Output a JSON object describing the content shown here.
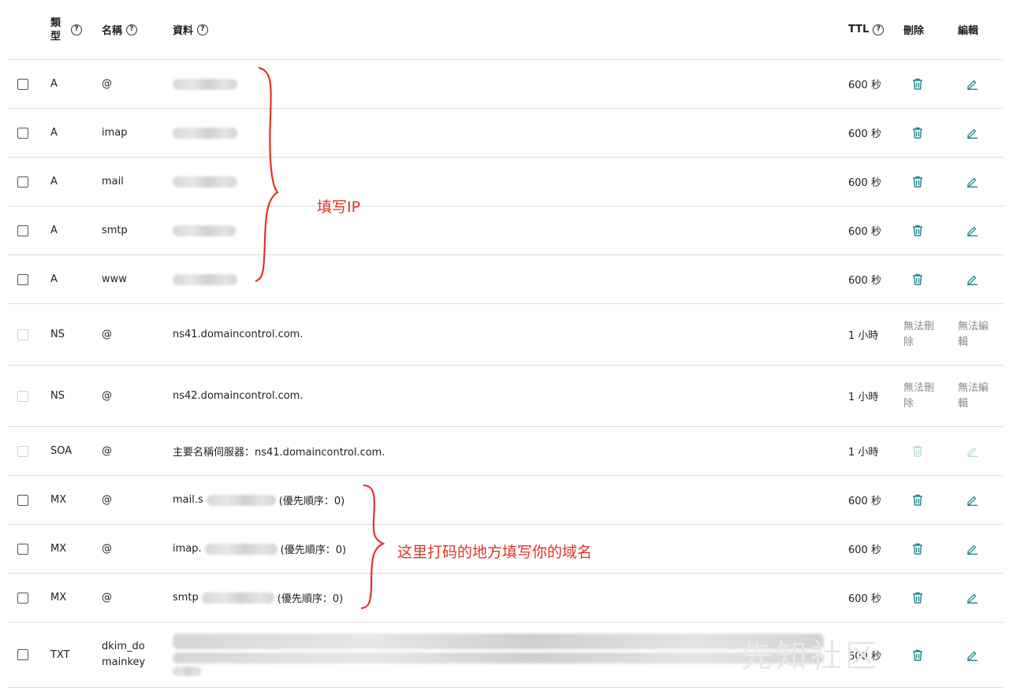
{
  "header": {
    "type_label": "類型",
    "name_label": "名稱",
    "data_label": "資料",
    "ttl_label": "TTL",
    "delete_label": "刪除",
    "edit_label": "編輯"
  },
  "rows": [
    {
      "type": "A",
      "name": "@",
      "data": "",
      "ttl": "600 秒"
    },
    {
      "type": "A",
      "name": "imap",
      "data": "",
      "ttl": "600 秒"
    },
    {
      "type": "A",
      "name": "mail",
      "data": "",
      "ttl": "600 秒"
    },
    {
      "type": "A",
      "name": "smtp",
      "data": "",
      "ttl": "600 秒"
    },
    {
      "type": "A",
      "name": "www",
      "data": "",
      "ttl": "600 秒"
    },
    {
      "type": "NS",
      "name": "@",
      "data": "ns41.domaincontrol.com.",
      "ttl": "1 小時",
      "delete": "無法刪除",
      "edit": "無法編輯"
    },
    {
      "type": "NS",
      "name": "@",
      "data": "ns42.domaincontrol.com.",
      "ttl": "1 小時",
      "delete": "無法刪除",
      "edit": "無法編輯"
    },
    {
      "type": "SOA",
      "name": "@",
      "data": "主要名稱伺服器：ns41.domaincontrol.com.",
      "ttl": "1 小時"
    },
    {
      "type": "MX",
      "name": "@",
      "data_prefix": "mail.s",
      "data_suffix": "(優先順序：0)",
      "ttl": "600 秒"
    },
    {
      "type": "MX",
      "name": "@",
      "data_prefix": "imap.",
      "data_suffix": "(優先順序：0)",
      "ttl": "600 秒"
    },
    {
      "type": "MX",
      "name": "@",
      "data_prefix": "smtp",
      "data_suffix": "(優先順序：0)",
      "ttl": "600 秒"
    },
    {
      "type": "TXT",
      "name": "dkim_domainkey",
      "data": "",
      "ttl": "600 秒"
    }
  ],
  "annotations": {
    "ip_note": "填写IP",
    "domain_note": "这里打码的地方填写你的域名",
    "annotation_color": "#e03427"
  },
  "watermark": "先知社区",
  "colors": {
    "accent": "#1a8a8a",
    "disabled_icon": "#b9dcdc",
    "divider": "#d9d9d9"
  }
}
